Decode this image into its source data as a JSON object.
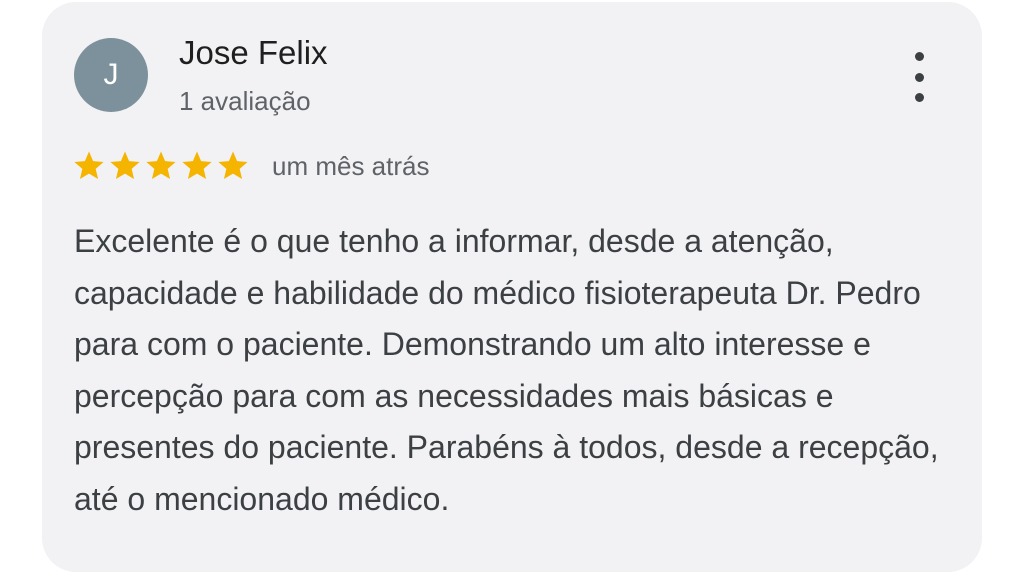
{
  "review": {
    "author": {
      "initial": "J",
      "name": "Jose Felix",
      "review_count": "1 avaliação",
      "avatar_color": "#7d919d"
    },
    "rating": 5,
    "max_rating": 5,
    "star_color": "#f4b400",
    "date": "um mês atrás",
    "text": "Excelente é o que tenho a informar, desde a atenção, capacidade e habilidade do médico fisioterapeuta Dr. Pedro para com o paciente. Demonstrando um alto interesse e percepção para com as necessidades mais básicas e presentes do paciente. Parabéns à todos, desde a recepção, até o mencionado médico.",
    "menu_icon": "more-vertical-icon"
  }
}
